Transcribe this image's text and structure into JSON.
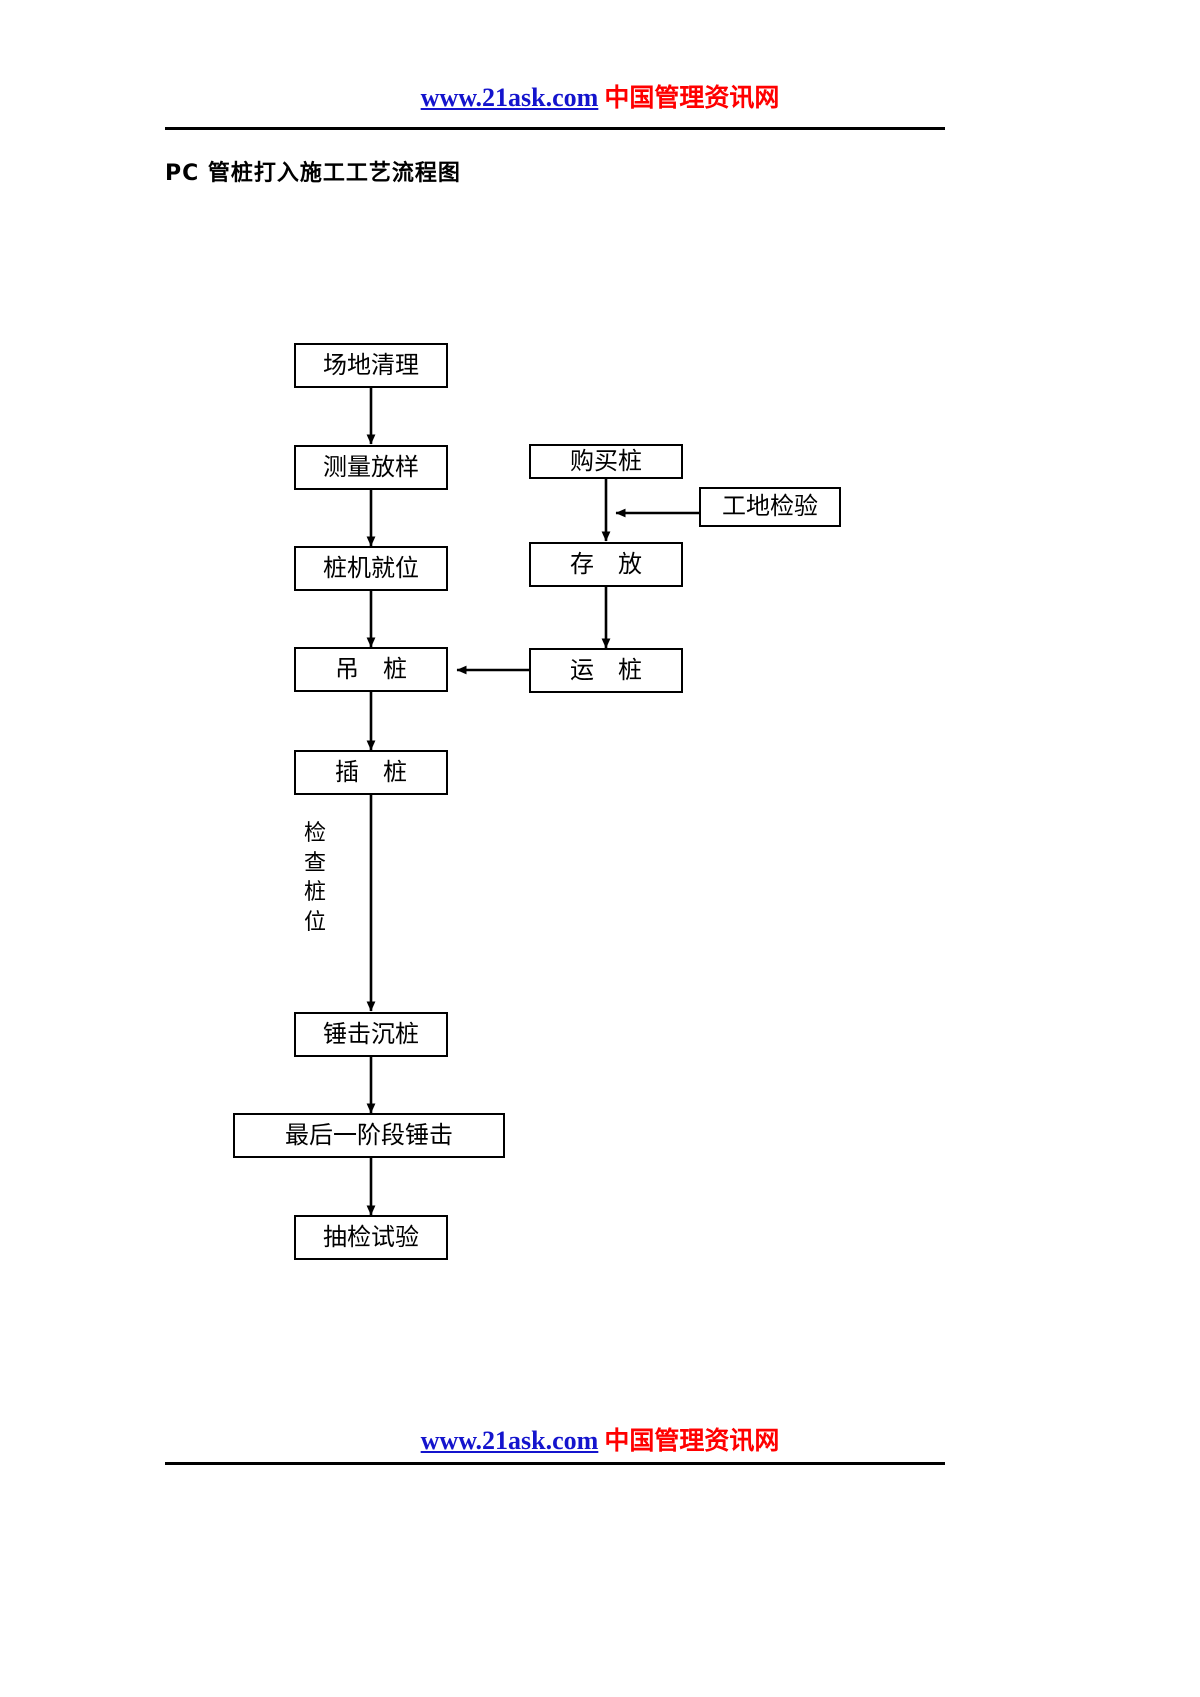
{
  "header": {
    "url_text": "www.21ask.com",
    "site_name": "中国管理资讯网",
    "url_color": "#1414cd",
    "site_color": "#ff0000"
  },
  "footer": {
    "url_text": "www.21ask.com",
    "site_name": "中国管理资讯网",
    "url_color": "#1414cd",
    "site_color": "#ff0000"
  },
  "document": {
    "title": "PC 管桩打入施工工艺流程图"
  },
  "flowchart": {
    "annotation_vertical": "检查桩位",
    "nodes": [
      {
        "id": "n1",
        "label": "场地清理"
      },
      {
        "id": "n2",
        "label": "测量放样"
      },
      {
        "id": "n3",
        "label": "桩机就位"
      },
      {
        "id": "n4",
        "label": "吊　桩"
      },
      {
        "id": "n5",
        "label": "插　桩"
      },
      {
        "id": "n6",
        "label": "锤击沉桩"
      },
      {
        "id": "n7",
        "label": "最后一阶段锤击"
      },
      {
        "id": "n8",
        "label": "抽检试验"
      },
      {
        "id": "n9",
        "label": "购买桩"
      },
      {
        "id": "n10",
        "label": "工地检验"
      },
      {
        "id": "n11",
        "label": "存　放"
      },
      {
        "id": "n12",
        "label": "运　桩"
      }
    ]
  }
}
